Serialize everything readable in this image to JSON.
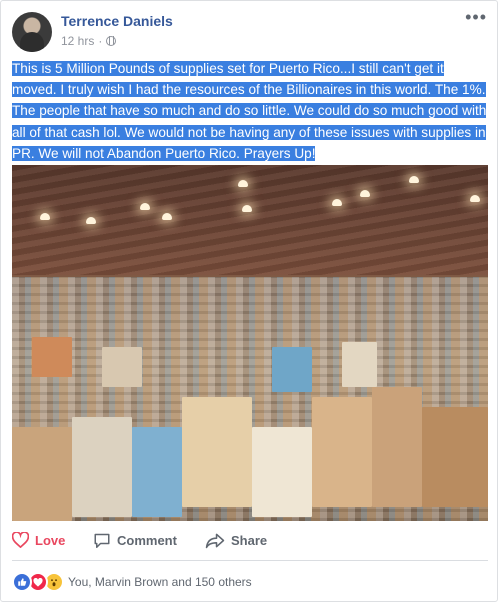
{
  "post": {
    "author": "Terrence Daniels",
    "time": "12 hrs",
    "separator": "·",
    "more_label": "•••",
    "text": "This is 5 Million Pounds of supplies set for Puerto Rico...I still can't get it moved. I truly wish I had the resources of the Billionaires in this world. The 1%. The people that have so much and do so little. We could do so much good with all of that cash lol. We would not be having any of these issues with supplies in PR. We will not Abandon Puerto Rico. Prayers Up!",
    "text_highlight_color": "#3a7fe0"
  },
  "actions": {
    "love_label": "Love",
    "comment_label": "Comment",
    "share_label": "Share"
  },
  "reactions": {
    "summary": "You, Marvin Brown and 150 others",
    "icons": [
      "like-icon",
      "heart-icon",
      "wow-icon"
    ]
  },
  "colors": {
    "author_link": "#365899",
    "love": "#e9475f",
    "muted": "#606770"
  }
}
